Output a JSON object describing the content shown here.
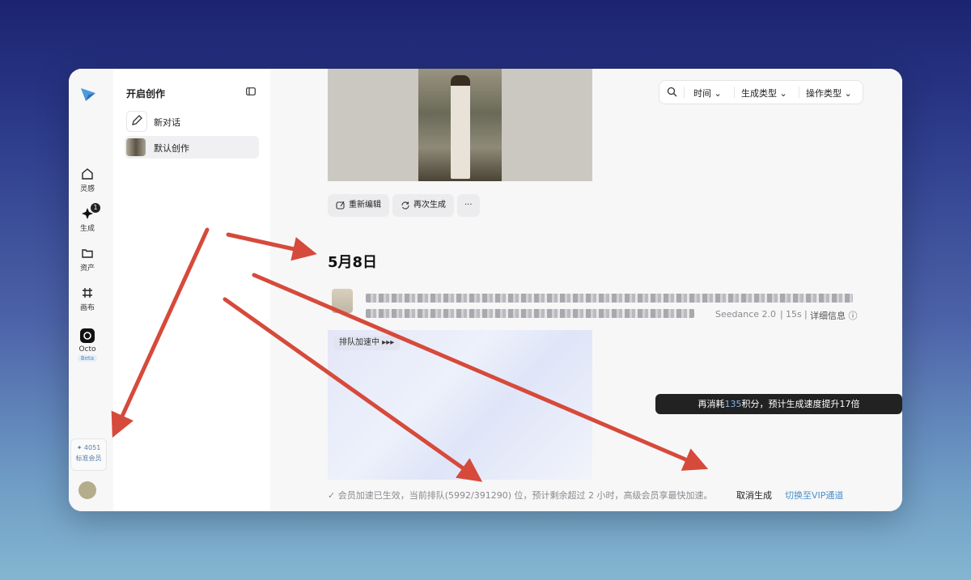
{
  "rail": {
    "items": [
      {
        "label": "灵感",
        "icon": "home-icon"
      },
      {
        "label": "生成",
        "icon": "sparkle-icon",
        "badge": "1"
      },
      {
        "label": "资产",
        "icon": "folder-icon"
      },
      {
        "label": "画布",
        "icon": "canvas-icon"
      },
      {
        "label": "Octo",
        "icon": "octo-icon",
        "tag": "Beta"
      }
    ],
    "credits": {
      "amount": "✦ 4051",
      "plan": "标准会员"
    }
  },
  "sidebar": {
    "title": "开启创作",
    "items": [
      {
        "label": "新对话",
        "icon": "edit-icon"
      },
      {
        "label": "默认创作",
        "icon": "thumbnail"
      }
    ]
  },
  "filters": {
    "time": "时间",
    "gen_type": "生成类型",
    "op_type": "操作类型"
  },
  "actions": {
    "re_edit": "重新编辑",
    "regenerate": "再次生成",
    "more": "···"
  },
  "date": "5月8日",
  "task": {
    "model": "Seedance 2.0",
    "duration": "15s",
    "details": "详细信息",
    "tag": "排队加速中 ▸▸▸"
  },
  "queue": {
    "prefix": "会员加速已生效，当前排队(",
    "position": "5992",
    "total": "/391290",
    "suffix": ") 位，预计剩余超过 2 小时，高级会员享最快加速。",
    "cancel": "取消生成",
    "switch": "切换至VIP通道"
  },
  "tooltip": {
    "before": "再消耗",
    "credits": "135",
    "after": "积分，预计生成速度提升17倍"
  },
  "colors": {
    "accent": "#4a8fc8",
    "arrow": "#d64a3b",
    "tooltip_bg": "#222222"
  }
}
